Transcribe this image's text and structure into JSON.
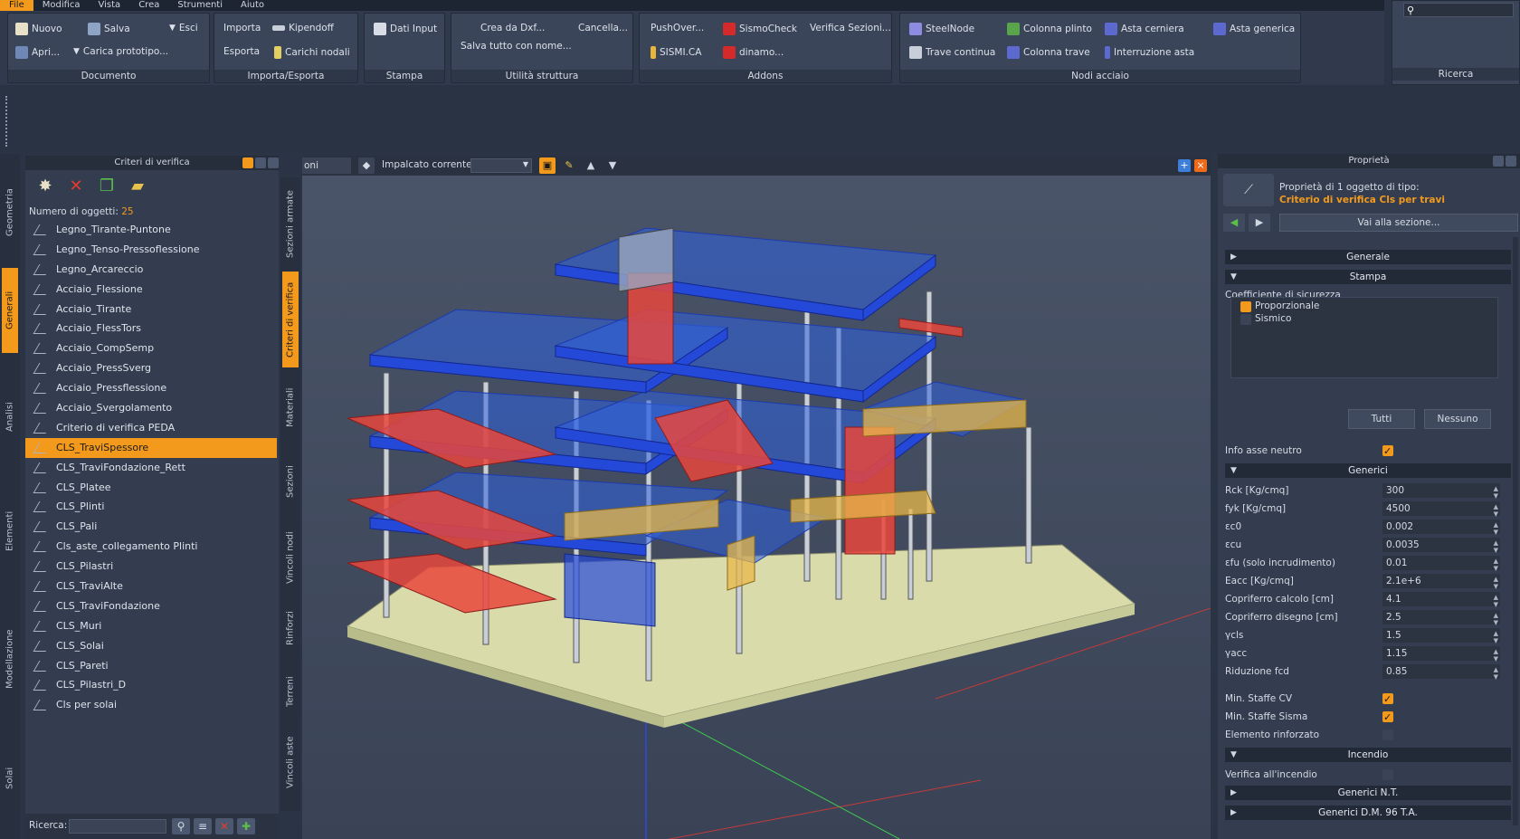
{
  "menubar": [
    "File",
    "Modifica",
    "Vista",
    "Crea",
    "Strumenti",
    "Aiuto"
  ],
  "ribbon": {
    "documento": {
      "title": "Documento",
      "nuovo": "Nuovo",
      "salva": "Salva",
      "esci": "Esci",
      "apri": "Apri...",
      "carica": "Carica prototipo..."
    },
    "importa": {
      "title": "Importa/Esporta",
      "importa": "Importa",
      "kipendoff": "Kipendoff",
      "esporta": "Esporta",
      "carichi": "Carichi nodali"
    },
    "stampa": {
      "title": "Stampa",
      "dati": "Dati Input"
    },
    "utilita": {
      "title": "Utilità struttura",
      "crea": "Crea da Dxf...",
      "cancella": "Cancella...",
      "salva_tutto": "Salva tutto con nome..."
    },
    "addons": {
      "title": "Addons",
      "pushover": "PushOver...",
      "sismocheck": "SismoCheck",
      "verifica": "Verifica Sezioni...",
      "sismica": "SISMI.CA",
      "dinamo": "dinamo..."
    },
    "nodi": {
      "title": "Nodi acciaio",
      "steelnode": "SteelNode",
      "colonna_plinto": "Colonna plinto",
      "asta_cerniera": "Asta cerniera",
      "asta_generica": "Asta generica",
      "trave_continua": "Trave continua",
      "colonna_trave": "Colonna trave",
      "interruzione": "Interruzione asta"
    },
    "ricerca": {
      "title": "Ricerca"
    }
  },
  "left_vtabs": [
    "Geometria",
    "Generali",
    "Analisi",
    "Elementi",
    "Modellazione",
    "Solai"
  ],
  "mid_vtabs": [
    "Sezioni armate",
    "Criteri di verifica",
    "Materiali",
    "Sezioni",
    "Vincoli nodi",
    "Rinforzi",
    "Terreni",
    "Vincoli aste"
  ],
  "left_panel": {
    "title": "Criteri di verifica",
    "count_label": "Numero di oggetti:",
    "count_value": "25",
    "items": [
      "Legno_Tirante-Puntone",
      "Legno_Tenso-Pressoflessione",
      "Legno_Arcareccio",
      "Acciaio_Flessione",
      "Acciaio_Tirante",
      "Acciaio_FlessTors",
      "Acciaio_CompSemp",
      "Acciaio_PressSverg",
      "Acciaio_Pressflessione",
      "Acciaio_Svergolamento",
      "Criterio di verifica PEDA",
      "CLS_TraviSpessore",
      "CLS_TraviFondazione_Rett",
      "CLS_Platee",
      "CLS_Plinti",
      "CLS_Pali",
      "Cls_aste_collegamento Plinti",
      "CLS_Pilastri",
      "CLS_TraviAlte",
      "CLS_TraviFondazione",
      "CLS_Muri",
      "CLS_Solai",
      "CLS_Pareti",
      "CLS_Pilastri_D",
      "Cls per solai"
    ],
    "selected_index": 11,
    "search_label": "Ricerca:"
  },
  "viewport": {
    "tab": "oni vista...",
    "impalcato": "Impalcato corrente:"
  },
  "right_panel": {
    "title": "Proprietà",
    "props_line1": "Proprietà di 1 oggetto di tipo:",
    "props_line2": "Criterio di verifica Cls per travi",
    "goto": "Vai alla sezione...",
    "sec_generale": "Generale",
    "sec_stampa": "Stampa",
    "coeff": "Coefficiente di sicurezza",
    "opt1": "Proporzionale",
    "opt2": "Sismico",
    "tutti": "Tutti",
    "nessuno": "Nessuno",
    "info_asse": "Info asse neutro",
    "sec_generici": "Generici",
    "rows": [
      {
        "label": "Rck [Kg/cmq]",
        "value": "300"
      },
      {
        "label": "fyk [Kg/cmq]",
        "value": "4500"
      },
      {
        "label": "εc0",
        "value": "0.002"
      },
      {
        "label": "εcu",
        "value": "0.0035"
      },
      {
        "label": "εfu (solo incrudimento)",
        "value": "0.01"
      },
      {
        "label": "Eacc [Kg/cmq]",
        "value": "2.1e+6"
      },
      {
        "label": "Copriferro calcolo [cm]",
        "value": "4.1"
      },
      {
        "label": "Copriferro disegno [cm]",
        "value": "2.5"
      },
      {
        "label": "γcls",
        "value": "1.5"
      },
      {
        "label": "γacc",
        "value": "1.15"
      },
      {
        "label": "Riduzione fcd",
        "value": "0.85"
      }
    ],
    "min_staffe_cv": "Min. Staffe CV",
    "min_staffe_sisma": "Min. Staffe Sisma",
    "elemento": "Elemento rinforzato",
    "sec_incendio": "Incendio",
    "verifica_incendio": "Verifica all'incendio",
    "sec_nt": "Generici N.T.",
    "sec_dm": "Generici D.M. 96 T.A."
  }
}
